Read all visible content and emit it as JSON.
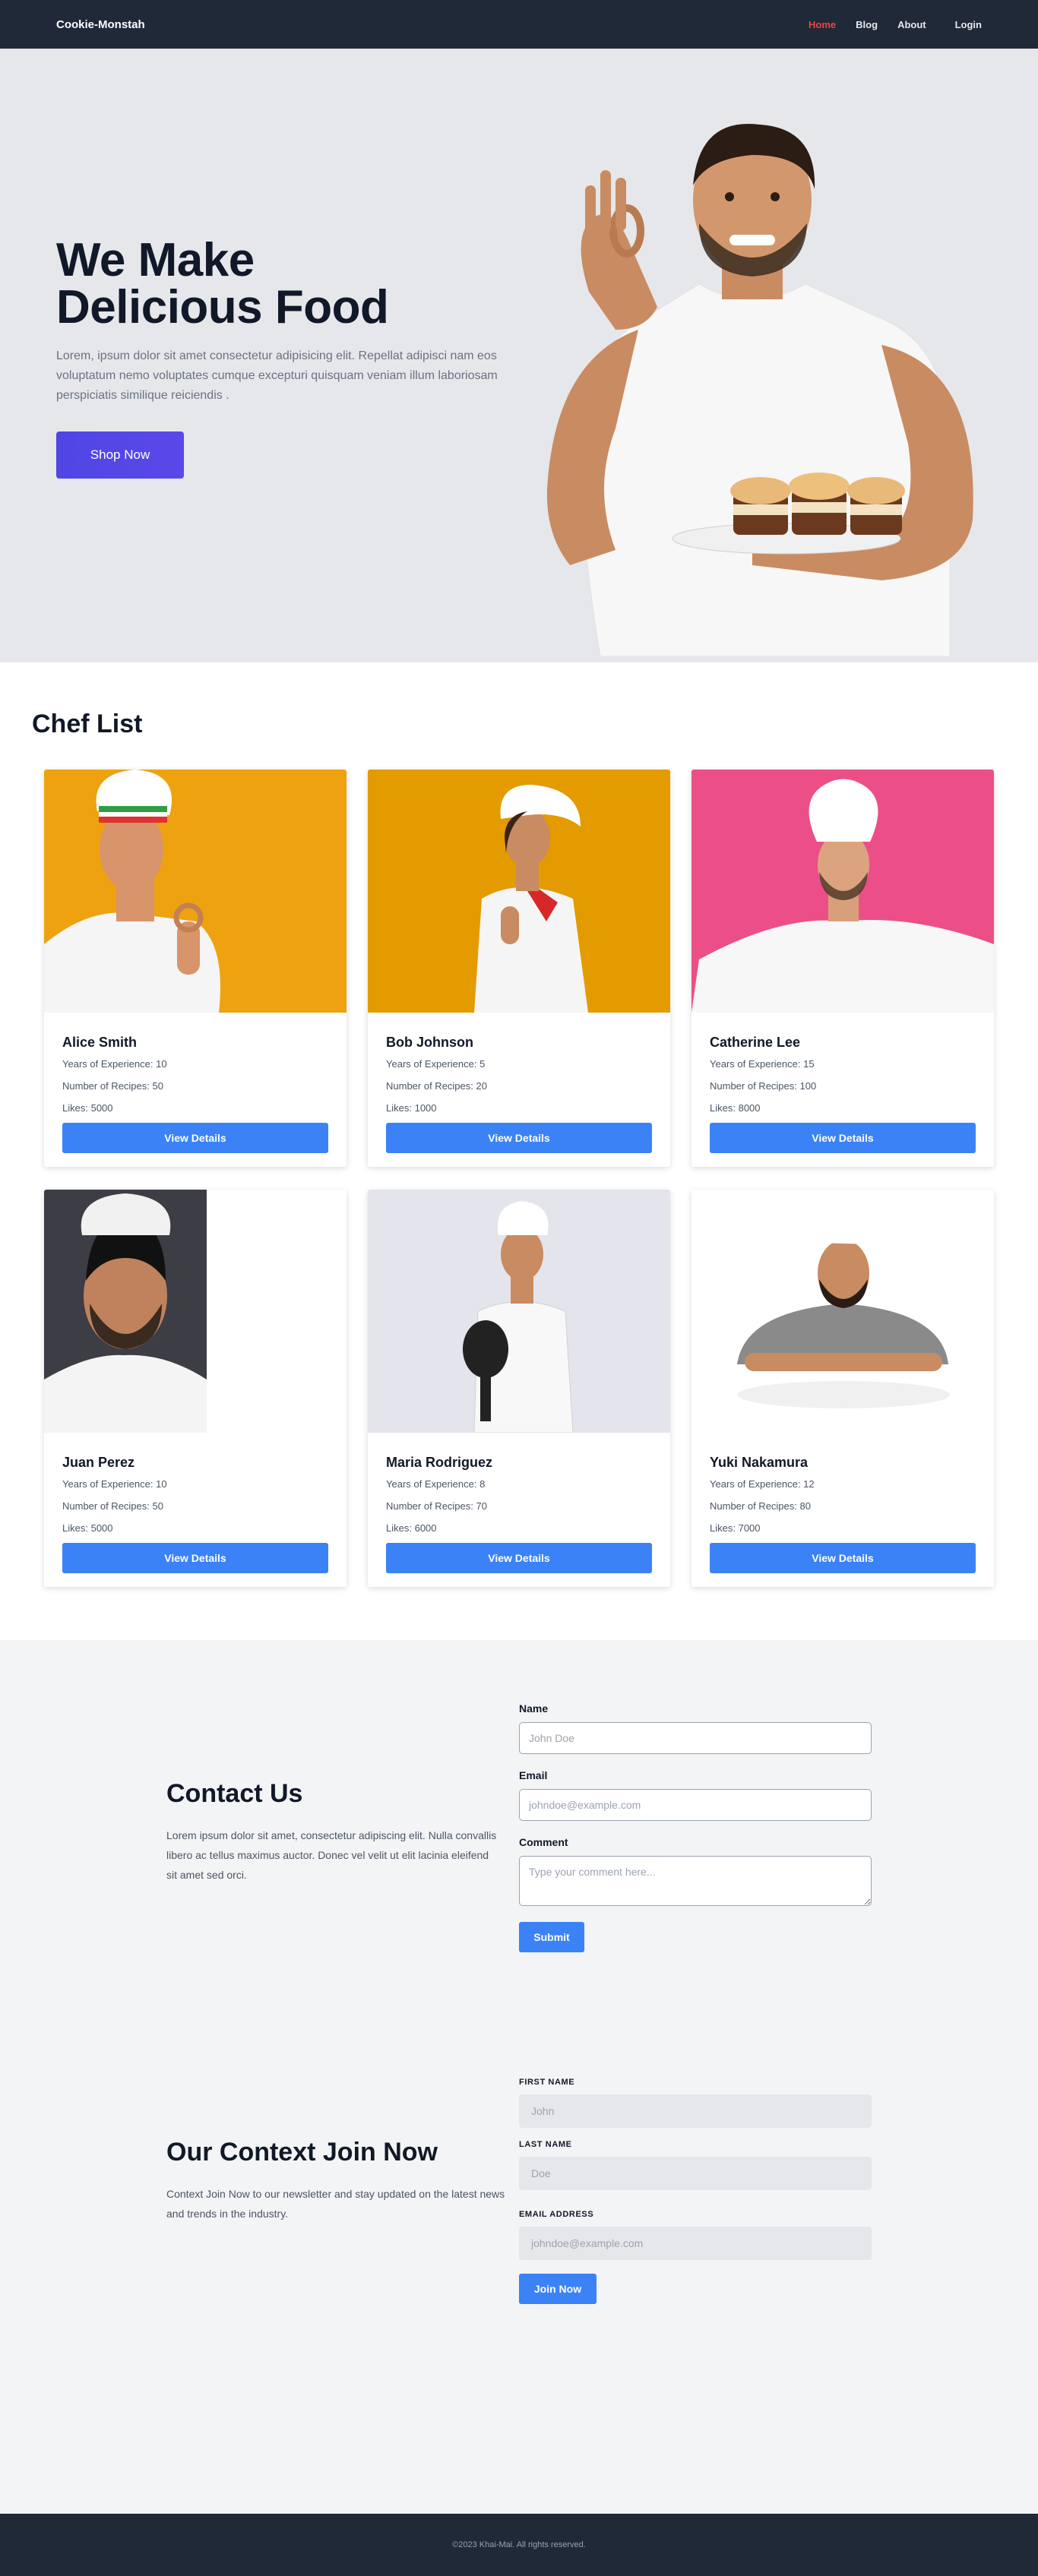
{
  "nav": {
    "brand": "Cookie-Monstah",
    "links": [
      {
        "label": "Home",
        "active": true
      },
      {
        "label": "Blog",
        "active": false
      },
      {
        "label": "About",
        "active": false
      },
      {
        "label": "Login",
        "active": false
      }
    ],
    "accent_color": "#ef4444"
  },
  "hero": {
    "title_line1": "We Make",
    "title_line2": "Delicious Food",
    "description": "Lorem, ipsum dolor sit amet consectetur adipisicing elit. Repellat adipisci nam eos voluptatum nemo voluptates cumque excepturi quisquam veniam illum laboriosam perspiciatis similique reiciendis .",
    "button_label": "Shop Now",
    "button_color": "#4f46e5"
  },
  "chefs": {
    "title": "Chef List",
    "button_label": "View Details",
    "experience_label": "Years of Experience:",
    "recipes_label": "Number of Recipes:",
    "likes_label": "Likes:",
    "list": [
      {
        "name": "Alice Smith",
        "experience": "10",
        "recipes": "50",
        "likes": "5000",
        "photo_bg": "#f0a500"
      },
      {
        "name": "Bob Johnson",
        "experience": "5",
        "recipes": "20",
        "likes": "1000",
        "photo_bg": "#e8a000"
      },
      {
        "name": "Catherine Lee",
        "experience": "15",
        "recipes": "100",
        "likes": "8000",
        "photo_bg": "#ec5a8c"
      },
      {
        "name": "Juan Perez",
        "experience": "10",
        "recipes": "50",
        "likes": "5000",
        "photo_bg": "#3d3d45"
      },
      {
        "name": "Maria Rodriguez",
        "experience": "8",
        "recipes": "70",
        "likes": "6000",
        "photo_bg": "#e4e4ec"
      },
      {
        "name": "Yuki Nakamura",
        "experience": "12",
        "recipes": "80",
        "likes": "7000",
        "photo_bg": "#ffffff"
      }
    ]
  },
  "contact": {
    "title": "Contact Us",
    "description": "Lorem ipsum dolor sit amet, consectetur adipiscing elit. Nulla convallis libero ac tellus maximus auctor. Donec vel velit ut elit lacinia eleifend sit amet sed orci.",
    "name_label": "Name",
    "name_placeholder": "John Doe",
    "email_label": "Email",
    "email_placeholder": "johndoe@example.com",
    "comment_label": "Comment",
    "comment_placeholder": "Type your comment here...",
    "submit_label": "Submit"
  },
  "join": {
    "title": "Our Context Join Now",
    "description": "Context Join Now to our newsletter and stay updated on the latest news and trends in the industry.",
    "first_label": "FIRST NAME",
    "first_placeholder": "John",
    "last_label": "LAST NAME",
    "last_placeholder": "Doe",
    "email_label": "EMAIL ADDRESS",
    "email_placeholder": "johndoe@example.com",
    "button_label": "Join Now"
  },
  "footer": {
    "text": "©2023 Khai-Mai. All rights reserved."
  }
}
